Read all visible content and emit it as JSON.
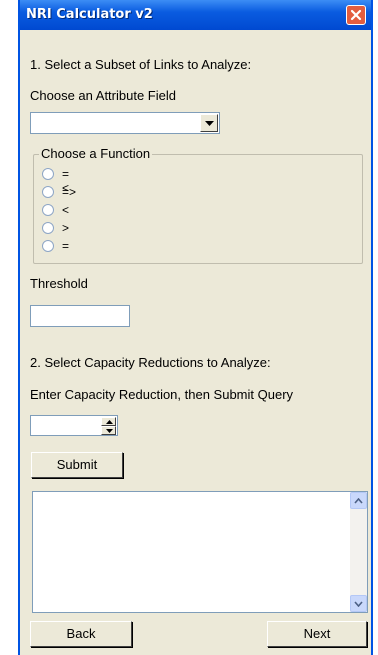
{
  "window": {
    "title": "NRI Calculator v2"
  },
  "section1": {
    "heading": "1. Select a Subset of Links to Analyze:",
    "attribute_label": "Choose an Attribute Field",
    "attribute_value": ""
  },
  "function_group": {
    "title": "Choose a Function",
    "options": [
      {
        "label": "=<"
      },
      {
        "label": "=>"
      },
      {
        "label": "<"
      },
      {
        "label": ">"
      },
      {
        "label": "="
      }
    ]
  },
  "threshold": {
    "label": "Threshold",
    "value": ""
  },
  "section2": {
    "heading": "2. Select Capacity Reductions to Analyze:",
    "instruction": "Enter Capacity Reduction, then Submit Query",
    "capacity_value": ""
  },
  "buttons": {
    "submit": "Submit",
    "back": "Back",
    "next": "Next"
  },
  "results": {
    "text": ""
  },
  "icons": {
    "close": "close-icon",
    "dropdown": "chevron-down-icon",
    "spin_up": "arrow-up-icon",
    "spin_down": "arrow-down-icon"
  },
  "colors": {
    "titlebar": "#0a5ce0",
    "window_bg": "#ece9d8",
    "close_button": "#e35d3f"
  }
}
